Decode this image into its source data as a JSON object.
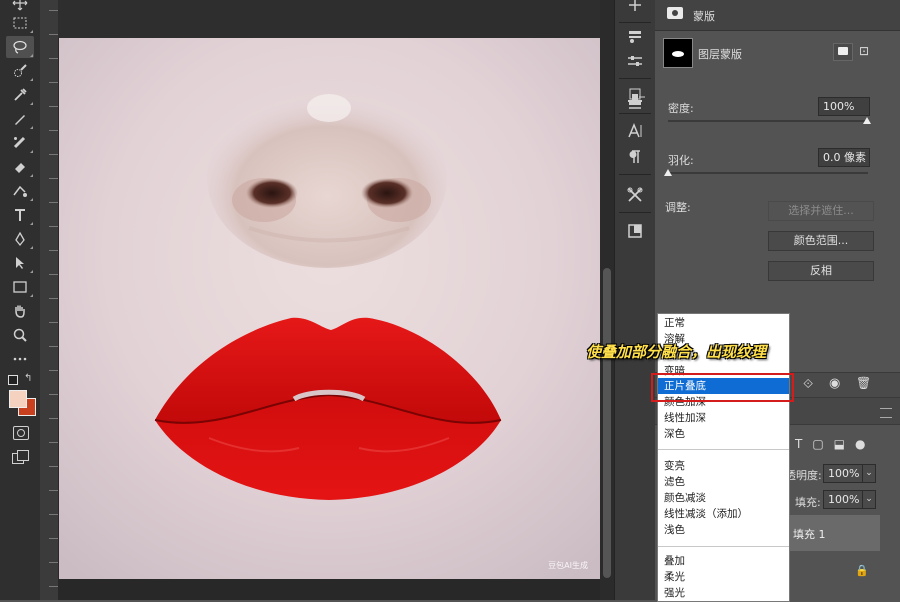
{
  "properties_panel": {
    "tab_title": "蒙版",
    "layer_mask_label": "图层蒙版",
    "density_label": "密度:",
    "density_value": "100%",
    "feather_label": "羽化:",
    "feather_value": "0.0 像素",
    "adjust_label": "调整:",
    "select_mask_button": "选择并遮住...",
    "color_range_button": "颜色范围...",
    "invert_button": "反相"
  },
  "layers_panel": {
    "opacity_label": "透明度:",
    "opacity_value": "100%",
    "fill_label": "填充:",
    "fill_value": "100%",
    "layer_name": "填充 1"
  },
  "blend_menu": {
    "items": [
      "正常",
      "溶解",
      "变暗",
      "正片叠底",
      "颜色加深",
      "线性加深",
      "深色",
      "变亮",
      "滤色",
      "颜色减淡",
      "线性减淡（添加）",
      "浅色",
      "叠加",
      "柔光",
      "强光"
    ],
    "selected": "正片叠底"
  },
  "annotation": "使叠加部分融合，出现纹理",
  "watermark": "豆包AI生成",
  "colors": {
    "foreground": "#f4d2bf",
    "background": "#c8401e",
    "lip_red": "#e10f0f",
    "menu_highlight": "#0f6cd4",
    "annotation_text": "#ffe04a",
    "highlight_box": "#d51c1c"
  },
  "icons": {
    "toolbar": [
      "move-icon",
      "marquee-icon",
      "lasso-icon",
      "quick-select-icon",
      "eyedropper-icon",
      "brush-icon",
      "healing-icon",
      "stamp-icon",
      "eraser-icon",
      "gradient-icon",
      "type-icon",
      "pen-icon",
      "path-select-icon",
      "rectangle-icon",
      "hand-icon",
      "zoom-icon",
      "more-icon"
    ],
    "dock": [
      "history-icon",
      "adjust-icon",
      "layer-comps-icon",
      "character-icon",
      "paragraph-icon",
      "tools-icon",
      "frame-icon"
    ]
  }
}
